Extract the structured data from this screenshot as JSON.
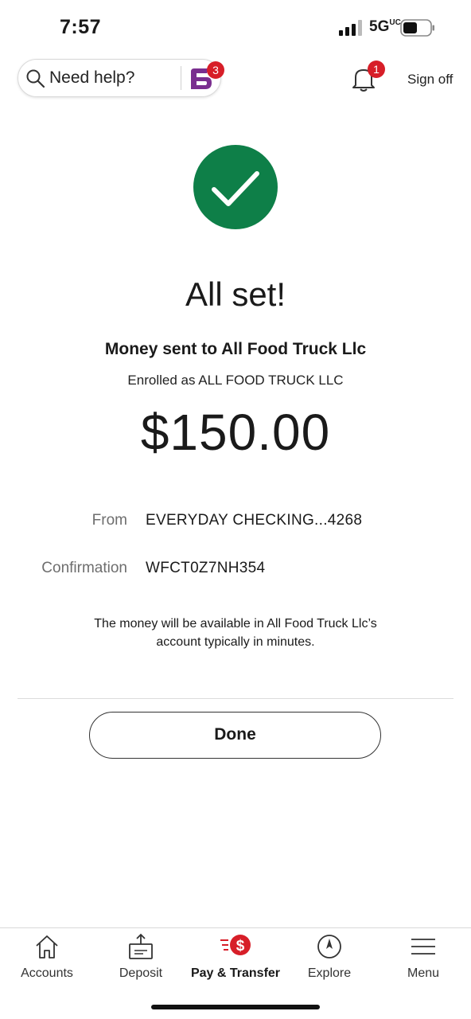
{
  "status_bar": {
    "time": "7:57",
    "network": "5G",
    "network_sup": "UC"
  },
  "header": {
    "search_placeholder": "Need help?",
    "fargo_badge_count": "3",
    "notifications_count": "1",
    "sign_off_label": "Sign off"
  },
  "confirmation": {
    "title": "All set!",
    "subtitle": "Money sent to All Food Truck Llc",
    "enrolled": "Enrolled as ALL FOOD TRUCK LLC",
    "amount": "$150.00",
    "from_label": "From",
    "from_value": "EVERYDAY CHECKING...4268",
    "confirmation_label": "Confirmation",
    "confirmation_value": "WFCT0Z7NH354",
    "note_line1": "The money will be available in All Food Truck Llc’s",
    "note_line2": "account typically in minutes.",
    "done_label": "Done"
  },
  "bottom_nav": {
    "accounts": "Accounts",
    "deposit": "Deposit",
    "pay_transfer": "Pay & Transfer",
    "explore": "Explore",
    "menu": "Menu"
  },
  "colors": {
    "success_green": "#0e7f48",
    "brand_red": "#d71e28",
    "fargo_purple": "#7a2e8f"
  }
}
